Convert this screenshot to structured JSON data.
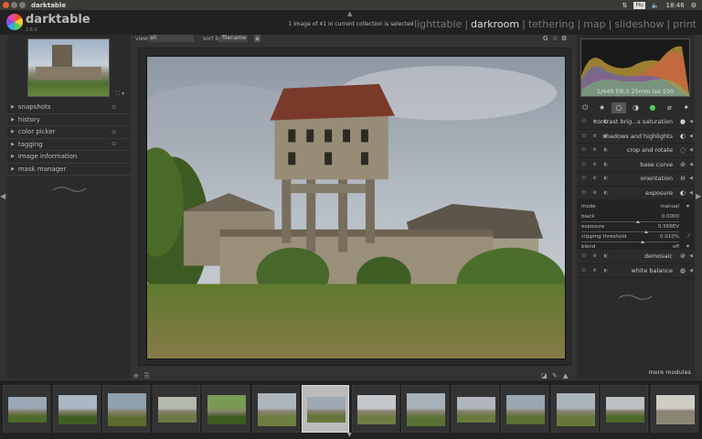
{
  "window": {
    "title": "darktable",
    "tray": {
      "keyboard": "Hu",
      "time": "18:46"
    }
  },
  "header": {
    "logo_name": "darktable",
    "logo_version": "2.6.0",
    "status": "1 image of 41 in current collection is selected",
    "views": [
      "lighttable",
      "darkroom",
      "tethering",
      "map",
      "slideshow",
      "print"
    ],
    "active_view": "darkroom"
  },
  "left_panel": {
    "modules": [
      {
        "label": "snapshots",
        "reset": true
      },
      {
        "label": "history",
        "reset": false
      },
      {
        "label": "color picker",
        "reset": true
      },
      {
        "label": "tagging",
        "reset": true
      },
      {
        "label": "image information",
        "reset": false
      },
      {
        "label": "mask manager",
        "reset": false
      }
    ]
  },
  "center": {
    "view_label": "view",
    "view_value": "all",
    "sort_label": "sort by",
    "sort_value": "filename"
  },
  "right_panel": {
    "histogram_info": "1/640 f/8.0 25mm iso 100",
    "modules": [
      {
        "name": "contrast brig...s saturation",
        "icon": "●"
      },
      {
        "name": "shadows and highlights",
        "icon": "◐"
      },
      {
        "name": "crop and rotate",
        "icon": "◌"
      },
      {
        "name": "base curve",
        "icon": "⊘"
      },
      {
        "name": "orientation",
        "icon": "⊖"
      },
      {
        "name": "exposure",
        "icon": "◐"
      }
    ],
    "exposure_params": [
      {
        "label": "mode",
        "value": "manual",
        "type": "combo"
      },
      {
        "label": "black",
        "value": "0.0000",
        "type": "slider",
        "position": 0.5
      },
      {
        "label": "exposure",
        "value": "0.566EV",
        "type": "slider",
        "position": 0.58
      },
      {
        "label": "clipping threshold",
        "value": "0.010%",
        "type": "slider",
        "position": 0.55
      },
      {
        "label": "blend",
        "value": "off",
        "type": "combo"
      }
    ],
    "modules_after": [
      {
        "name": "demosaic",
        "icon": "⊘"
      },
      {
        "name": "white balance",
        "icon": "◍"
      }
    ],
    "more_modules": "more modules"
  },
  "filmstrip": {
    "count": 14,
    "selected_index": 6
  },
  "colors": {
    "panel_bg": "#2b2b2b",
    "header_bg": "#212121",
    "active_view": "#dddddd",
    "inactive_view": "#777777"
  }
}
